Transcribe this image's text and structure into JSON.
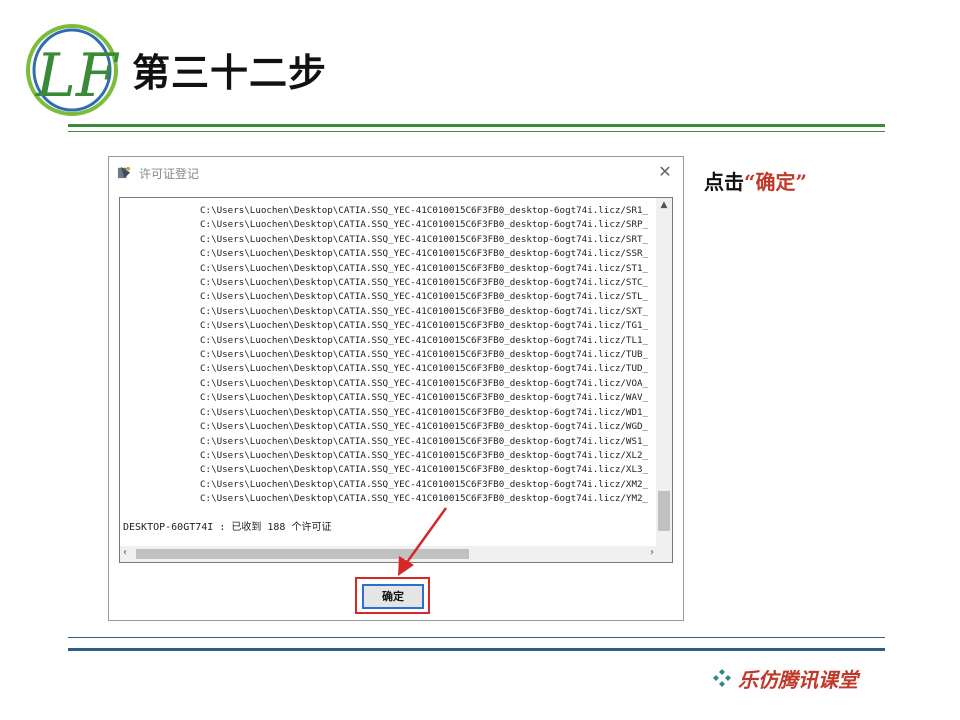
{
  "slide": {
    "title": "第三十二步",
    "instruction_prefix": "点击",
    "instruction_highlight": "“确定”",
    "footer_brand": "乐仿腾讯课堂",
    "logo_text": "LF"
  },
  "dialog": {
    "title": "许可证登记",
    "close_symbol": "✕",
    "ok_label": "确定",
    "log_lines": [
      "C:\\Users\\Luochen\\Desktop\\CATIA.SSQ_YEC-41C010015C6F3FB0_desktop-6ogt74i.licz/SR1_",
      "C:\\Users\\Luochen\\Desktop\\CATIA.SSQ_YEC-41C010015C6F3FB0_desktop-6ogt74i.licz/SRP_",
      "C:\\Users\\Luochen\\Desktop\\CATIA.SSQ_YEC-41C010015C6F3FB0_desktop-6ogt74i.licz/SRT_",
      "C:\\Users\\Luochen\\Desktop\\CATIA.SSQ_YEC-41C010015C6F3FB0_desktop-6ogt74i.licz/SSR_",
      "C:\\Users\\Luochen\\Desktop\\CATIA.SSQ_YEC-41C010015C6F3FB0_desktop-6ogt74i.licz/ST1_",
      "C:\\Users\\Luochen\\Desktop\\CATIA.SSQ_YEC-41C010015C6F3FB0_desktop-6ogt74i.licz/STC_",
      "C:\\Users\\Luochen\\Desktop\\CATIA.SSQ_YEC-41C010015C6F3FB0_desktop-6ogt74i.licz/STL_",
      "C:\\Users\\Luochen\\Desktop\\CATIA.SSQ_YEC-41C010015C6F3FB0_desktop-6ogt74i.licz/SXT_",
      "C:\\Users\\Luochen\\Desktop\\CATIA.SSQ_YEC-41C010015C6F3FB0_desktop-6ogt74i.licz/TG1_",
      "C:\\Users\\Luochen\\Desktop\\CATIA.SSQ_YEC-41C010015C6F3FB0_desktop-6ogt74i.licz/TL1_",
      "C:\\Users\\Luochen\\Desktop\\CATIA.SSQ_YEC-41C010015C6F3FB0_desktop-6ogt74i.licz/TUB_",
      "C:\\Users\\Luochen\\Desktop\\CATIA.SSQ_YEC-41C010015C6F3FB0_desktop-6ogt74i.licz/TUD_",
      "C:\\Users\\Luochen\\Desktop\\CATIA.SSQ_YEC-41C010015C6F3FB0_desktop-6ogt74i.licz/VOA_",
      "C:\\Users\\Luochen\\Desktop\\CATIA.SSQ_YEC-41C010015C6F3FB0_desktop-6ogt74i.licz/WAV_",
      "C:\\Users\\Luochen\\Desktop\\CATIA.SSQ_YEC-41C010015C6F3FB0_desktop-6ogt74i.licz/WD1_",
      "C:\\Users\\Luochen\\Desktop\\CATIA.SSQ_YEC-41C010015C6F3FB0_desktop-6ogt74i.licz/WGD_",
      "C:\\Users\\Luochen\\Desktop\\CATIA.SSQ_YEC-41C010015C6F3FB0_desktop-6ogt74i.licz/WS1_",
      "C:\\Users\\Luochen\\Desktop\\CATIA.SSQ_YEC-41C010015C6F3FB0_desktop-6ogt74i.licz/XL2_",
      "C:\\Users\\Luochen\\Desktop\\CATIA.SSQ_YEC-41C010015C6F3FB0_desktop-6ogt74i.licz/XL3_",
      "C:\\Users\\Luochen\\Desktop\\CATIA.SSQ_YEC-41C010015C6F3FB0_desktop-6ogt74i.licz/XM2_",
      "C:\\Users\\Luochen\\Desktop\\CATIA.SSQ_YEC-41C010015C6F3FB0_desktop-6ogt74i.licz/YM2_"
    ],
    "status_line": "DESKTOP-60GT74I : 已收到 188 个许可证"
  },
  "colors": {
    "highlight_red": "#d62828",
    "header_rule": "#3a8a3a",
    "footer_rule": "#2e5d8a",
    "brand_red": "#c0392b"
  },
  "icons": {
    "app": "app-icon",
    "close": "close-icon",
    "scroll_up": "scroll-up-icon",
    "scroll_left": "scroll-left-icon",
    "scroll_right": "scroll-right-icon",
    "pointer_arrow": "pointer-arrow-icon",
    "footer": "diamond-cluster-icon"
  }
}
